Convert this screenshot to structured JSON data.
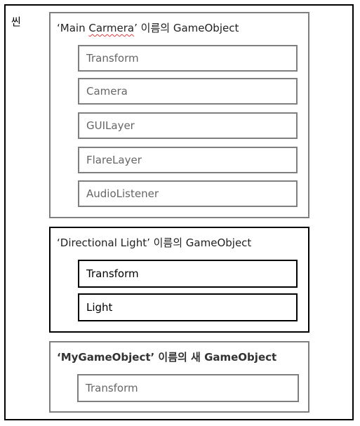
{
  "scene": {
    "label": "씬"
  },
  "gameobjects": [
    {
      "title_quote_open": "‘",
      "title_name_1": "Main ",
      "title_name_2": "Carmera",
      "title_rest": "’ 이름의 GameObject",
      "components": [
        "Transform",
        "Camera",
        "GUILayer",
        "FlareLayer",
        "AudioListener"
      ]
    },
    {
      "title": "‘Directional Light’ 이름의 GameObject",
      "components": [
        "Transform",
        "Light"
      ]
    },
    {
      "title": "‘MyGameObject’ 이름의 새 GameObject",
      "components": [
        "Transform"
      ]
    }
  ],
  "colors": {
    "gray_border": "#7f7f7f",
    "black_border": "#000000",
    "spellcheck": "#e03c3c"
  }
}
